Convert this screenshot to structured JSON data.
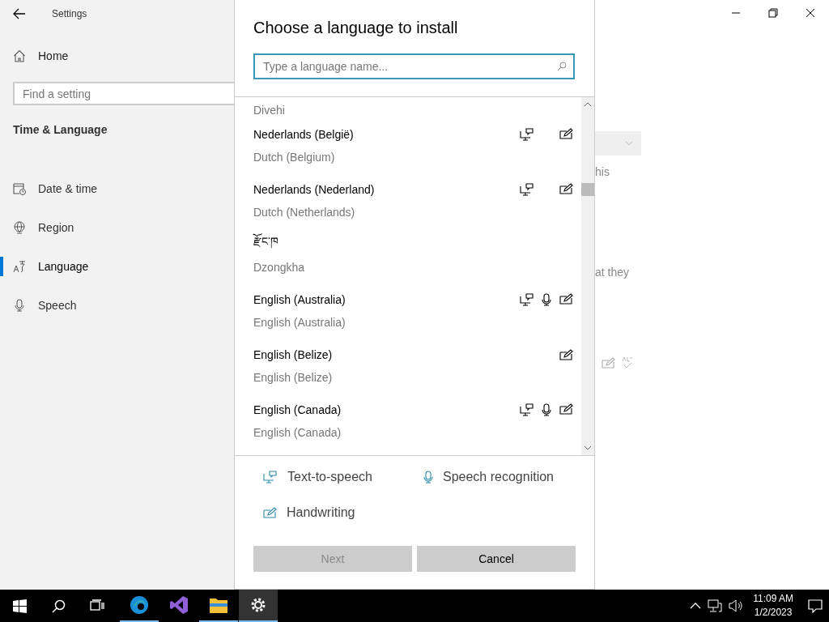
{
  "window": {
    "title": "Settings"
  },
  "sidebar": {
    "home": "Home",
    "search": {
      "placeholder": "Find a setting"
    },
    "section": "Time & Language",
    "items": [
      {
        "label": "Date & time",
        "kind": "calendar",
        "selected": false
      },
      {
        "label": "Region",
        "kind": "globe",
        "selected": false
      },
      {
        "label": "Language",
        "kind": "language",
        "selected": true
      },
      {
        "label": "Speech",
        "kind": "mic",
        "selected": false
      }
    ]
  },
  "background_page": {
    "texts": [
      "his",
      "at they"
    ]
  },
  "dialog": {
    "title": "Choose a language to install",
    "search": {
      "placeholder": "Type a language name..."
    },
    "languages": [
      {
        "english": "Divehi"
      },
      {
        "native": "Nederlands (België)",
        "english": "Dutch (Belgium)",
        "tts": true,
        "speech": false,
        "handwriting": true
      },
      {
        "native": "Nederlands (Nederland)",
        "english": "Dutch (Netherlands)",
        "tts": true,
        "speech": false,
        "handwriting": true
      },
      {
        "native": "རྫོང་ཁ",
        "english": "Dzongkha",
        "tts": false,
        "speech": false,
        "handwriting": false
      },
      {
        "native": "English (Australia)",
        "english": "English (Australia)",
        "tts": true,
        "speech": true,
        "handwriting": true
      },
      {
        "native": "English (Belize)",
        "english": "English (Belize)",
        "tts": false,
        "speech": false,
        "handwriting": true
      },
      {
        "native": "English (Canada)",
        "english": "English (Canada)",
        "tts": true,
        "speech": true,
        "handwriting": true
      }
    ],
    "legend": [
      {
        "kind": "tts",
        "label": "Text-to-speech"
      },
      {
        "kind": "speech",
        "label": "Speech recognition"
      },
      {
        "kind": "handwriting",
        "label": "Handwriting"
      }
    ],
    "buttons": [
      {
        "label": "Next",
        "disabled": true
      },
      {
        "label": "Cancel",
        "disabled": false
      }
    ]
  },
  "taskbar": {
    "apps": [
      {
        "kind": "edge",
        "running": true,
        "selected": false
      },
      {
        "kind": "studio",
        "running": false,
        "selected": false
      },
      {
        "kind": "explorer",
        "running": true,
        "selected": false
      },
      {
        "kind": "settings",
        "running": true,
        "selected": true
      }
    ],
    "time": "11:09 AM",
    "date": "1/2/2023"
  }
}
